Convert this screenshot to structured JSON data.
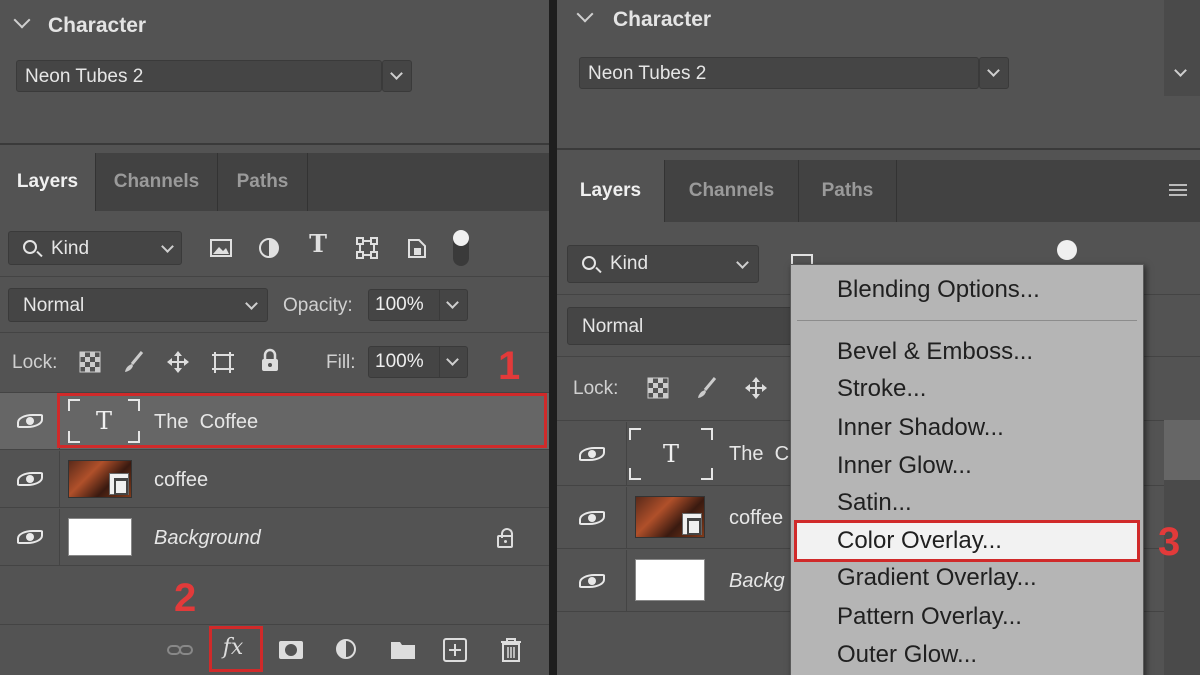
{
  "left": {
    "character": {
      "title": "Character",
      "font": "Neon Tubes 2"
    },
    "tabs": [
      "Layers",
      "Channels",
      "Paths"
    ],
    "filter": {
      "kind_label": "Kind"
    },
    "blend": {
      "mode": "Normal",
      "opacity_label": "Opacity:",
      "opacity": "100%"
    },
    "lock": {
      "label": "Lock:",
      "fill_label": "Fill:",
      "fill": "100%"
    },
    "layers": [
      {
        "name": "The  Coffee",
        "type": "text",
        "selected": true
      },
      {
        "name": "coffee",
        "type": "smart-object"
      },
      {
        "name": "Background",
        "type": "background",
        "locked": true
      }
    ],
    "steps": {
      "one": "1",
      "two": "2"
    }
  },
  "right": {
    "character": {
      "title": "Character",
      "font": "Neon Tubes 2"
    },
    "tabs": [
      "Layers",
      "Channels",
      "Paths"
    ],
    "filter": {
      "kind_label": "Kind"
    },
    "blend": {
      "mode": "Normal"
    },
    "lock": {
      "label": "Lock:"
    },
    "layers": [
      {
        "name": "The  C",
        "type": "text"
      },
      {
        "name": "coffee",
        "type": "smart-object"
      },
      {
        "name": "Backg",
        "type": "background"
      }
    ],
    "context_menu": {
      "items": [
        "Blending Options...",
        "Bevel & Emboss...",
        "Stroke...",
        "Inner Shadow...",
        "Inner Glow...",
        "Satin...",
        "Color Overlay...",
        "Gradient Overlay...",
        "Pattern Overlay...",
        "Outer Glow..."
      ],
      "highlighted": "Color Overlay..."
    },
    "steps": {
      "three": "3"
    }
  },
  "colors": {
    "panel": "#535353",
    "annotation_red": "#d02a2a",
    "menu_bg": "#b5b5b5"
  }
}
